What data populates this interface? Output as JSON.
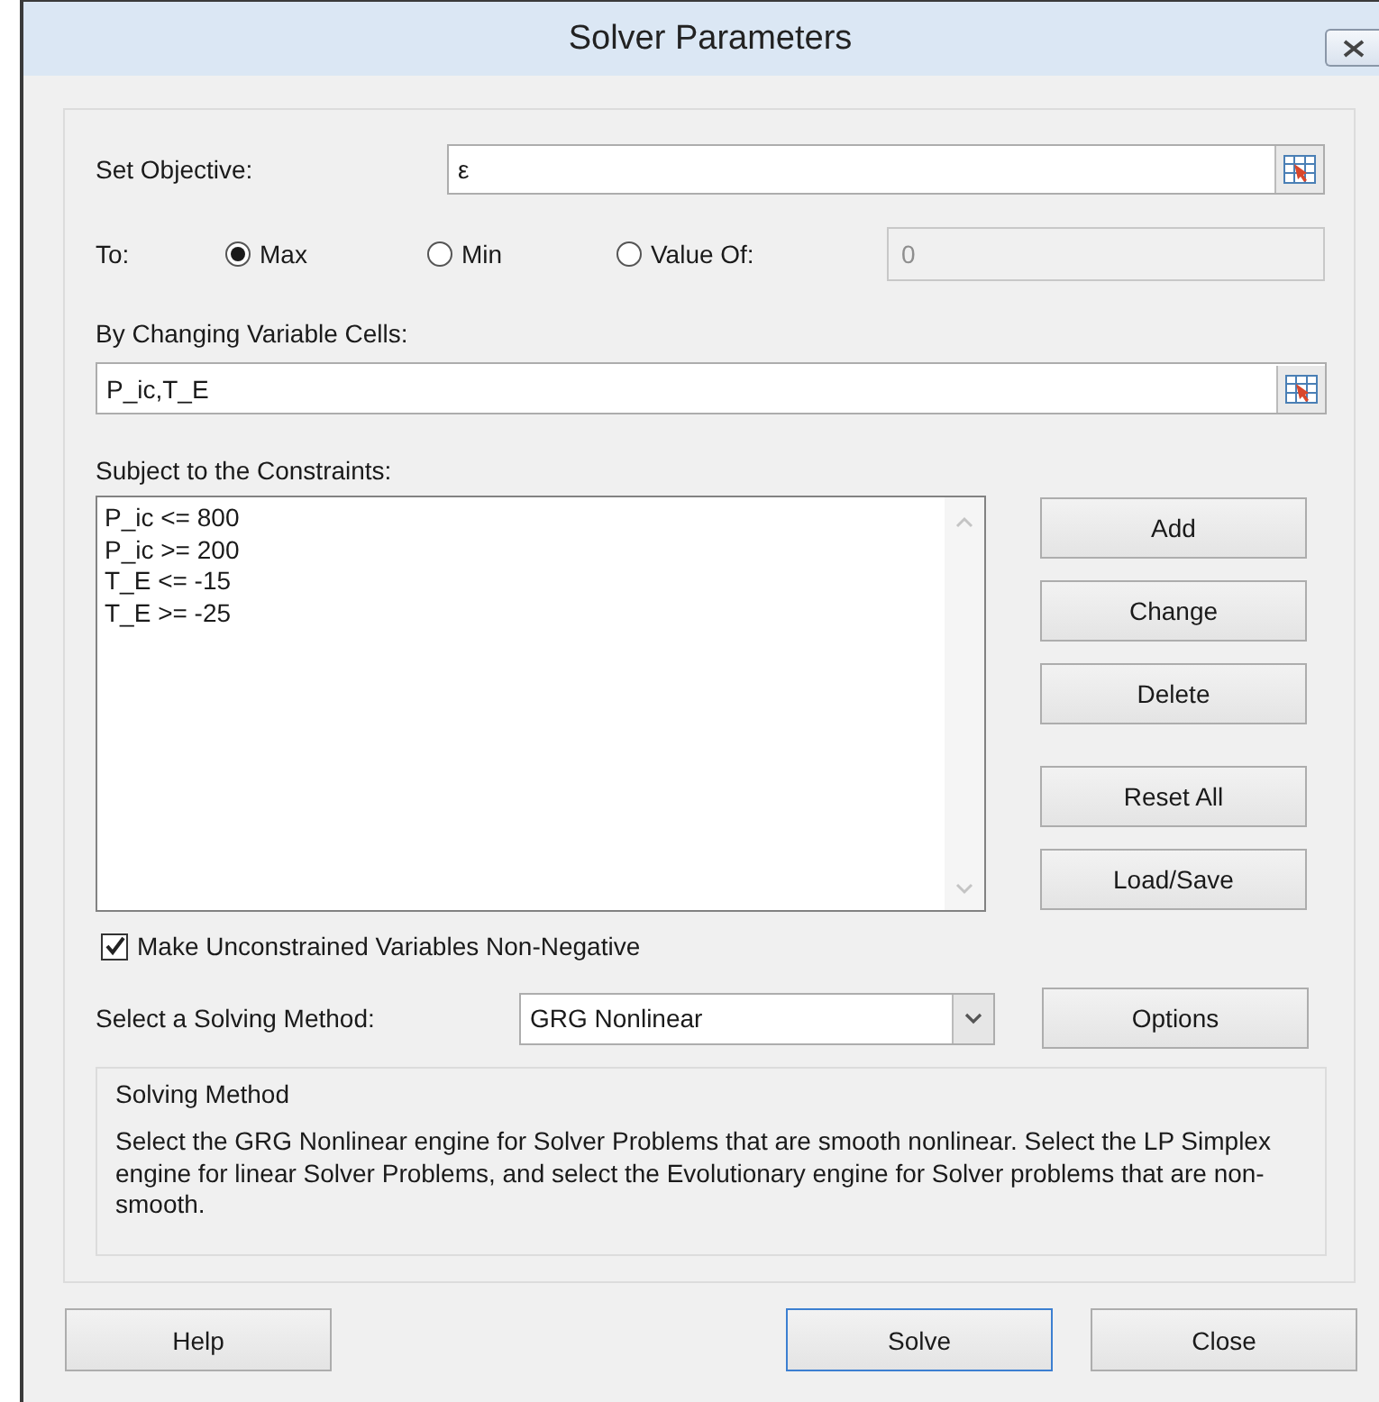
{
  "window": {
    "title": "Solver Parameters"
  },
  "objective": {
    "label": "Set Objective:",
    "value": "ε"
  },
  "to": {
    "label": "To:",
    "options": [
      {
        "label": "Max",
        "selected": true
      },
      {
        "label": "Min",
        "selected": false
      },
      {
        "label": "Value Of:",
        "selected": false
      }
    ],
    "value_of": {
      "value": "0",
      "disabled": true
    }
  },
  "changing": {
    "label": "By Changing Variable Cells:",
    "value": "P_ic,T_E"
  },
  "constraints": {
    "label": "Subject to the Constraints:",
    "items": [
      "P_ic <= 800",
      "P_ic >= 200",
      "T_E <= -15",
      "T_E >= -25"
    ]
  },
  "side_buttons": [
    "Add",
    "Change",
    "Delete",
    "Reset All",
    "Load/Save"
  ],
  "non_negative": {
    "label": "Make Unconstrained Variables Non-Negative",
    "checked": true
  },
  "method": {
    "label": "Select a Solving Method:",
    "value": "GRG Nonlinear"
  },
  "options_button": "Options",
  "description": {
    "title": "Solving Method",
    "text": "Select the GRG Nonlinear engine for Solver Problems that are smooth nonlinear. Select the LP Simplex engine for linear Solver Problems, and select the Evolutionary engine for Solver problems that are non-smooth."
  },
  "buttons": [
    {
      "label": "Help",
      "focused": false
    },
    {
      "label": "Solve",
      "focused": true
    },
    {
      "label": "Close",
      "focused": false
    }
  ]
}
